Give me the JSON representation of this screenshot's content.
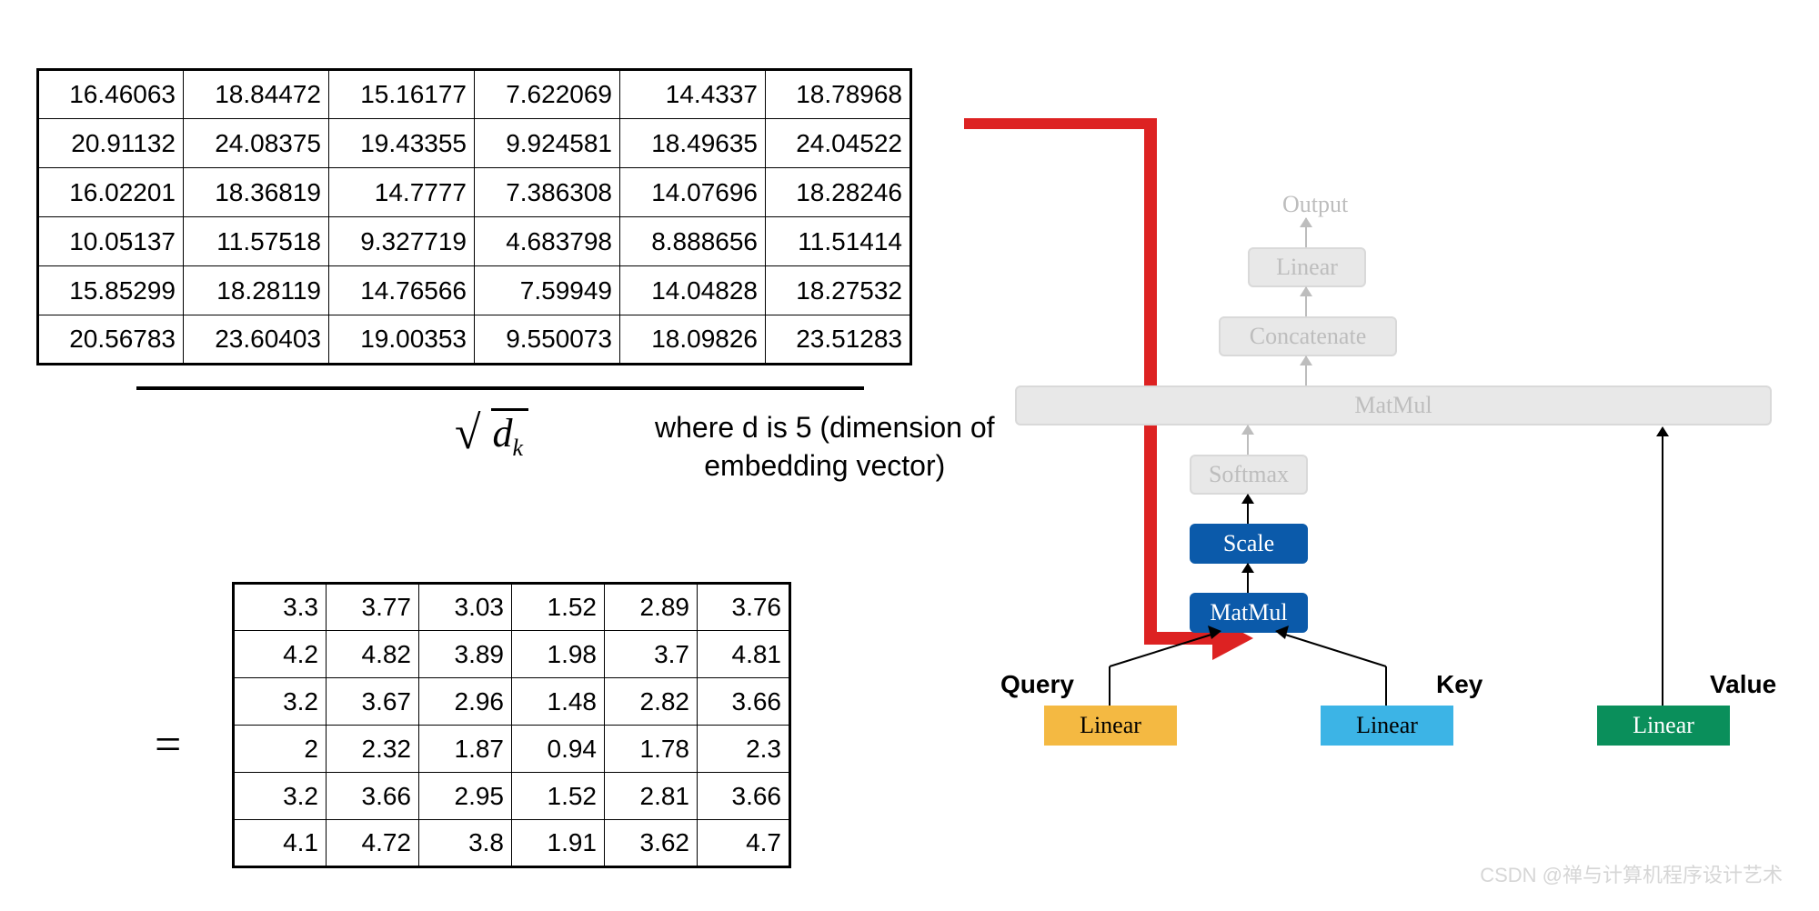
{
  "table_top": [
    [
      "16.46063",
      "18.84472",
      "15.16177",
      "7.622069",
      "14.4337",
      "18.78968"
    ],
    [
      "20.91132",
      "24.08375",
      "19.43355",
      "9.924581",
      "18.49635",
      "24.04522"
    ],
    [
      "16.02201",
      "18.36819",
      "14.7777",
      "7.386308",
      "14.07696",
      "18.28246"
    ],
    [
      "10.05137",
      "11.57518",
      "9.327719",
      "4.683798",
      "8.888656",
      "11.51414"
    ],
    [
      "15.85299",
      "18.28119",
      "14.76566",
      "7.59949",
      "14.04828",
      "18.27532"
    ],
    [
      "20.56783",
      "23.60403",
      "19.00353",
      "9.550073",
      "18.09826",
      "23.51283"
    ]
  ],
  "sqrt_display": "√",
  "sqrt_var": "d",
  "sqrt_sub": "k",
  "caption_l1": "where d is 5 (dimension of",
  "caption_l2": "embedding vector)",
  "equals": "=",
  "table_bottom": [
    [
      "3.3",
      "3.77",
      "3.03",
      "1.52",
      "2.89",
      "3.76"
    ],
    [
      "4.2",
      "4.82",
      "3.89",
      "1.98",
      "3.7",
      "4.81"
    ],
    [
      "3.2",
      "3.67",
      "2.96",
      "1.48",
      "2.82",
      "3.66"
    ],
    [
      "2",
      "2.32",
      "1.87",
      "0.94",
      "1.78",
      "2.3"
    ],
    [
      "3.2",
      "3.66",
      "2.95",
      "1.52",
      "2.81",
      "3.66"
    ],
    [
      "4.1",
      "4.72",
      "3.8",
      "1.91",
      "3.62",
      "4.7"
    ]
  ],
  "diagram": {
    "output": "Output",
    "linear_top": "Linear",
    "concat": "Concatenate",
    "matmul_top": "MatMul",
    "softmax": "Softmax",
    "scale": "Scale",
    "matmul": "MatMul",
    "query": "Query",
    "key": "Key",
    "value": "Value",
    "linear_q": "Linear",
    "linear_k": "Linear",
    "linear_v": "Linear"
  },
  "watermark": "CSDN @禅与计算机程序设计艺术"
}
